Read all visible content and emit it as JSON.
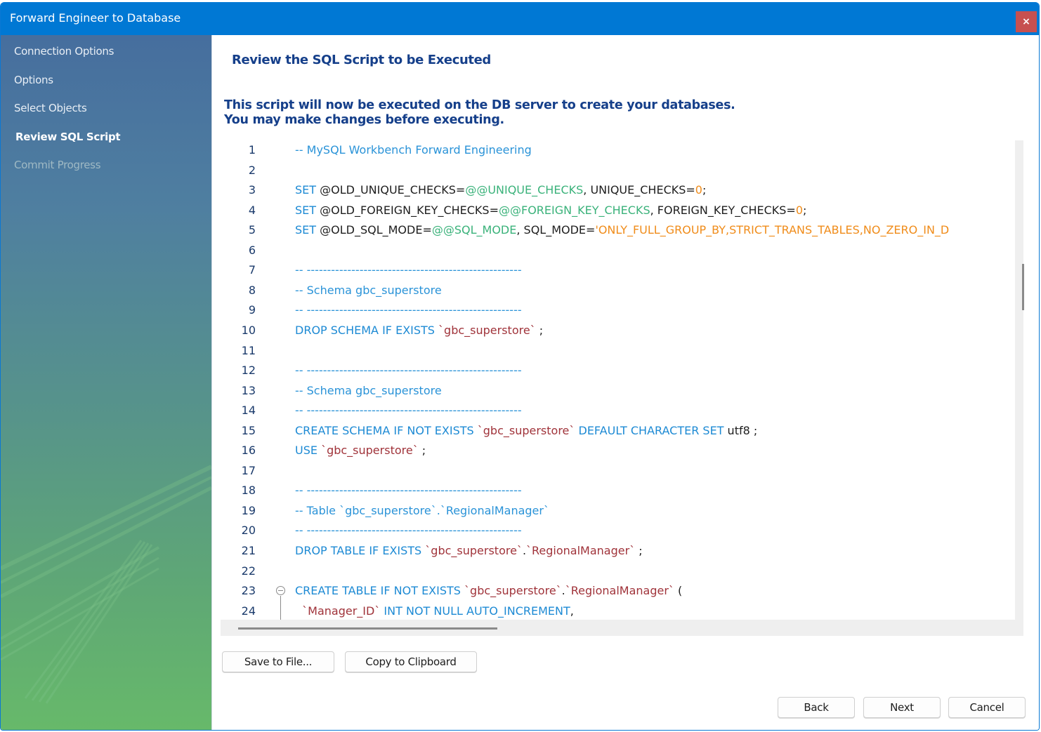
{
  "window": {
    "title": "Forward Engineer to Database",
    "close_label": "×"
  },
  "sidebar": {
    "items": [
      {
        "label": "Connection Options",
        "state": "done"
      },
      {
        "label": "Options",
        "state": "done"
      },
      {
        "label": "Select Objects",
        "state": "done"
      },
      {
        "label": "Review SQL Script",
        "state": "active"
      },
      {
        "label": "Commit Progress",
        "state": "pending"
      }
    ]
  },
  "main": {
    "title": "Review the SQL Script to be Executed",
    "description_line1": "This script will now be executed on the DB server to create your databases.",
    "description_line2": "You may make changes before executing."
  },
  "editor": {
    "lines": [
      {
        "n": "1",
        "tokens": [
          {
            "t": "-- MySQL Workbench Forward Engineering",
            "c": "cm"
          }
        ]
      },
      {
        "n": "2",
        "tokens": []
      },
      {
        "n": "3",
        "tokens": [
          {
            "t": "SET ",
            "c": "kw"
          },
          {
            "t": "@OLD_UNIQUE_CHECKS=",
            "c": "id"
          },
          {
            "t": "@@UNIQUE_CHECKS",
            "c": "sv"
          },
          {
            "t": ", UNIQUE_CHECKS=",
            "c": "id"
          },
          {
            "t": "0",
            "c": "num"
          },
          {
            "t": ";",
            "c": "id"
          }
        ]
      },
      {
        "n": "4",
        "tokens": [
          {
            "t": "SET ",
            "c": "kw"
          },
          {
            "t": "@OLD_FOREIGN_KEY_CHECKS=",
            "c": "id"
          },
          {
            "t": "@@FOREIGN_KEY_CHECKS",
            "c": "sv"
          },
          {
            "t": ", FOREIGN_KEY_CHECKS=",
            "c": "id"
          },
          {
            "t": "0",
            "c": "num"
          },
          {
            "t": ";",
            "c": "id"
          }
        ]
      },
      {
        "n": "5",
        "tokens": [
          {
            "t": "SET ",
            "c": "kw"
          },
          {
            "t": "@OLD_SQL_MODE=",
            "c": "id"
          },
          {
            "t": "@@SQL_MODE",
            "c": "sv"
          },
          {
            "t": ", SQL_MODE=",
            "c": "id"
          },
          {
            "t": "'ONLY_FULL_GROUP_BY,STRICT_TRANS_TABLES,NO_ZERO_IN_D",
            "c": "str"
          }
        ]
      },
      {
        "n": "6",
        "tokens": []
      },
      {
        "n": "7",
        "tokens": [
          {
            "t": "-- -----------------------------------------------------",
            "c": "cm"
          }
        ]
      },
      {
        "n": "8",
        "tokens": [
          {
            "t": "-- Schema gbc_superstore",
            "c": "cm"
          }
        ]
      },
      {
        "n": "9",
        "tokens": [
          {
            "t": "-- -----------------------------------------------------",
            "c": "cm"
          }
        ]
      },
      {
        "n": "10",
        "tokens": [
          {
            "t": "DROP SCHEMA IF EXISTS ",
            "c": "kw"
          },
          {
            "t": "`gbc_superstore`",
            "c": "qid"
          },
          {
            "t": " ;",
            "c": "id"
          }
        ]
      },
      {
        "n": "11",
        "tokens": []
      },
      {
        "n": "12",
        "tokens": [
          {
            "t": "-- -----------------------------------------------------",
            "c": "cm"
          }
        ]
      },
      {
        "n": "13",
        "tokens": [
          {
            "t": "-- Schema gbc_superstore",
            "c": "cm"
          }
        ]
      },
      {
        "n": "14",
        "tokens": [
          {
            "t": "-- -----------------------------------------------------",
            "c": "cm"
          }
        ]
      },
      {
        "n": "15",
        "tokens": [
          {
            "t": "CREATE SCHEMA IF NOT EXISTS ",
            "c": "kw"
          },
          {
            "t": "`gbc_superstore`",
            "c": "qid"
          },
          {
            "t": " DEFAULT CHARACTER SET ",
            "c": "kw"
          },
          {
            "t": "utf8",
            "c": "id"
          },
          {
            "t": " ;",
            "c": "id"
          }
        ]
      },
      {
        "n": "16",
        "tokens": [
          {
            "t": "USE ",
            "c": "kw"
          },
          {
            "t": "`gbc_superstore`",
            "c": "qid"
          },
          {
            "t": " ;",
            "c": "id"
          }
        ]
      },
      {
        "n": "17",
        "tokens": []
      },
      {
        "n": "18",
        "tokens": [
          {
            "t": "-- -----------------------------------------------------",
            "c": "cm"
          }
        ]
      },
      {
        "n": "19",
        "tokens": [
          {
            "t": "-- Table `gbc_superstore`.`RegionalManager`",
            "c": "cm"
          }
        ]
      },
      {
        "n": "20",
        "tokens": [
          {
            "t": "-- -----------------------------------------------------",
            "c": "cm"
          }
        ]
      },
      {
        "n": "21",
        "tokens": [
          {
            "t": "DROP TABLE IF EXISTS ",
            "c": "kw"
          },
          {
            "t": "`gbc_superstore`",
            "c": "qid"
          },
          {
            "t": ".",
            "c": "id"
          },
          {
            "t": "`RegionalManager`",
            "c": "qid"
          },
          {
            "t": " ;",
            "c": "id"
          }
        ]
      },
      {
        "n": "22",
        "tokens": []
      },
      {
        "n": "23",
        "fold": true,
        "tokens": [
          {
            "t": "CREATE TABLE IF NOT EXISTS ",
            "c": "kw"
          },
          {
            "t": "`gbc_superstore`",
            "c": "qid"
          },
          {
            "t": ".",
            "c": "id"
          },
          {
            "t": "`RegionalManager`",
            "c": "qid"
          },
          {
            "t": " (",
            "c": "id"
          }
        ]
      },
      {
        "n": "24",
        "tokens": [
          {
            "t": "  ",
            "c": "id"
          },
          {
            "t": "`Manager_ID`",
            "c": "qid"
          },
          {
            "t": " INT NOT NULL AUTO_INCREMENT",
            "c": "kw"
          },
          {
            "t": ",",
            "c": "id"
          }
        ]
      }
    ]
  },
  "buttons": {
    "save_to_file": "Save to File...",
    "copy_to_clipboard": "Copy to Clipboard",
    "back": "Back",
    "next": "Next",
    "cancel": "Cancel"
  }
}
